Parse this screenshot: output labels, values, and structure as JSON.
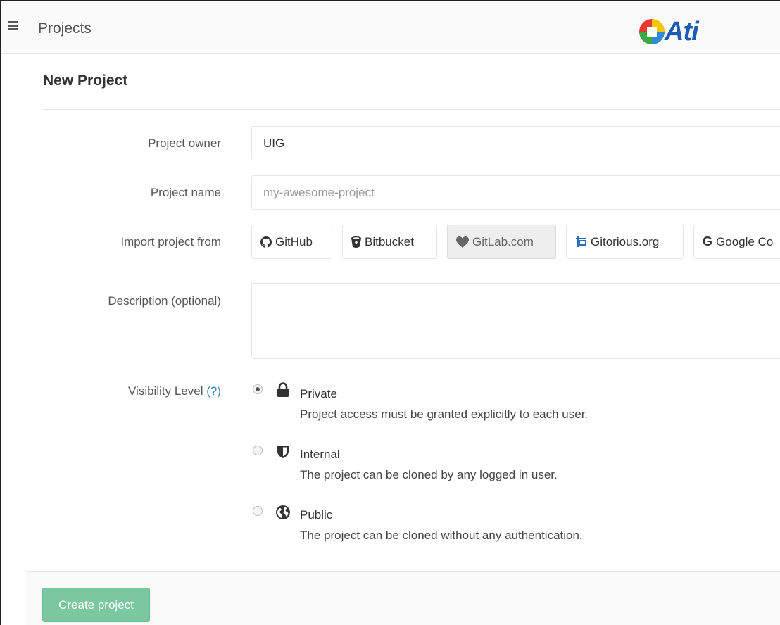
{
  "header": {
    "title": "Projects",
    "logo_text": "Ati"
  },
  "page": {
    "title": "New Project"
  },
  "form": {
    "owner_label": "Project owner",
    "owner_value": "UIG",
    "name_label": "Project name",
    "name_placeholder": "my-awesome-project",
    "import_label": "Import project from",
    "import_sources": [
      {
        "label": "GitHub",
        "icon": "github-icon"
      },
      {
        "label": "Bitbucket",
        "icon": "bitbucket-icon"
      },
      {
        "label": "GitLab.com",
        "icon": "heart-icon",
        "active": true
      },
      {
        "label": "Gitorious.org",
        "icon": "gitorious-icon"
      },
      {
        "label": "Google Co",
        "icon": "google-icon"
      }
    ],
    "description_label": "Description (optional)",
    "description_value": "",
    "visibility_label": "Visibility Level",
    "visibility_help": "(?)",
    "visibility_options": [
      {
        "name": "Private",
        "description": "Project access must be granted explicitly to each user.",
        "icon": "lock-icon",
        "checked": true
      },
      {
        "name": "Internal",
        "description": "The project can be cloned by any logged in user.",
        "icon": "shield-icon",
        "checked": false
      },
      {
        "name": "Public",
        "description": "The project can be cloned without any authentication.",
        "icon": "globe-icon",
        "checked": false
      }
    ]
  },
  "footer": {
    "create_label": "Create project"
  },
  "colors": {
    "accent_green": "#7ac7a0",
    "link_blue": "#3084bb",
    "logo_blue": "#1e5bb5"
  }
}
